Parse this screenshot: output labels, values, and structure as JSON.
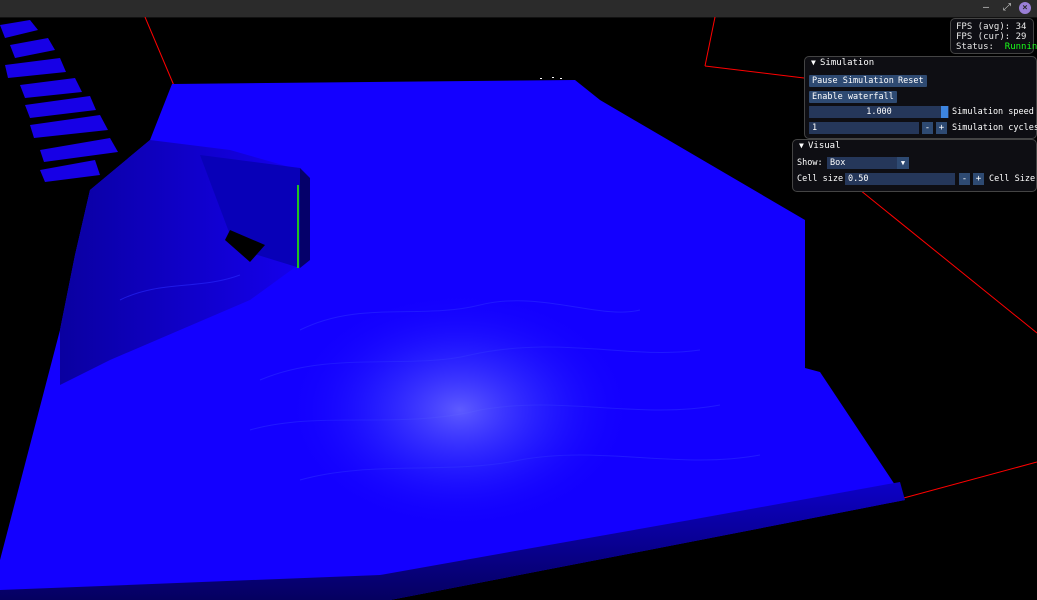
{
  "window": {
    "minimize_label": "–",
    "maximize_label": "⤢",
    "close_label": "×"
  },
  "stats": {
    "fps_avg_label": "FPS (avg):",
    "fps_avg_value": "34",
    "fps_cur_label": "FPS (cur):",
    "fps_cur_value": "29",
    "status_label": "Status:",
    "status_value": "Running"
  },
  "simulation": {
    "title": "Simulation",
    "pause_label": "Pause Simulation",
    "reset_label": "Reset",
    "waterfall_label": "Enable waterfall",
    "speed_value": "1.000",
    "speed_label": "Simulation speed",
    "cycles_value": "1",
    "cycles_label": "Simulation cycles",
    "minus": "-",
    "plus": "+"
  },
  "visual": {
    "title": "Visual",
    "show_label": "Show:",
    "show_value": "Box",
    "cell_size_label": "Cell size",
    "cell_size_value": "0.50",
    "cell_size_label_right": "Cell Size",
    "minus": "-",
    "plus": "+"
  },
  "colors": {
    "water": "#1200ff",
    "boundary_lines": "#ff0000",
    "status_running": "#1aff1a",
    "button": "#2e4a72",
    "slider_grab": "#3d85e0"
  }
}
